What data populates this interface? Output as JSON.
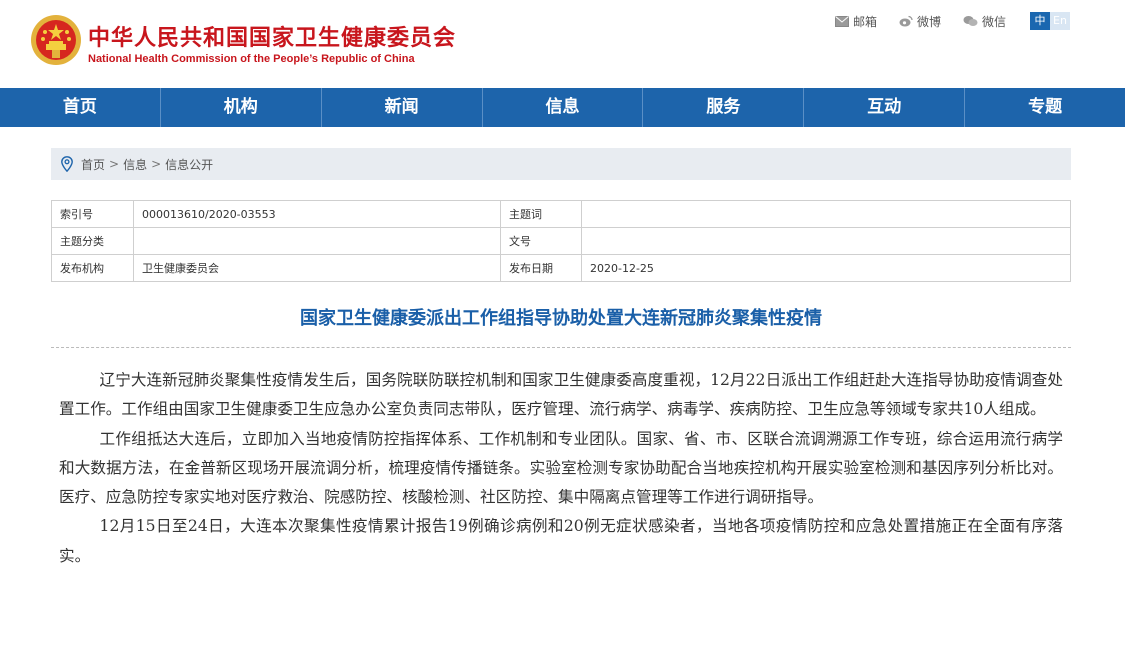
{
  "header": {
    "site_title_cn": "中华人民共和国国家卫生健康委员会",
    "site_title_en": "National Health Commission of the People’s Republic of China",
    "links": [
      {
        "label": "邮箱",
        "icon": "mail-icon"
      },
      {
        "label": "微博",
        "icon": "weibo-icon"
      },
      {
        "label": "微信",
        "icon": "wechat-icon"
      }
    ],
    "lang": {
      "zh": "中",
      "en": "En"
    }
  },
  "nav": {
    "items": [
      "首页",
      "机构",
      "新闻",
      "信息",
      "服务",
      "互动",
      "专题"
    ]
  },
  "breadcrumb": {
    "items": [
      "首页",
      "信息",
      "信息公开"
    ],
    "separator": ">"
  },
  "meta": {
    "rows": [
      {
        "k1": "索引号",
        "v1": "000013610/2020-03553",
        "k2": "主题词",
        "v2": ""
      },
      {
        "k1": "主题分类",
        "v1": "",
        "k2": "文号",
        "v2": ""
      },
      {
        "k1": "发布机构",
        "v1": "卫生健康委员会",
        "k2": "发布日期",
        "v2": "2020-12-25"
      }
    ]
  },
  "article": {
    "title": "国家卫生健康委派出工作组指导协助处置大连新冠肺炎聚集性疫情",
    "paragraphs": [
      "辽宁大连新冠肺炎聚集性疫情发生后，国务院联防联控机制和国家卫生健康委高度重视，12月22日派出工作组赶赴大连指导协助疫情调查处置工作。工作组由国家卫生健康委卫生应急办公室负责同志带队，医疗管理、流行病学、病毒学、疾病防控、卫生应急等领域专家共10人组成。",
      "工作组抵达大连后，立即加入当地疫情防控指挥体系、工作机制和专业团队。国家、省、市、区联合流调溯源工作专班，综合运用流行病学和大数据方法，在金普新区现场开展流调分析，梳理疫情传播链条。实验室检测专家协助配合当地疾控机构开展实验室检测和基因序列分析比对。医疗、应急防控专家实地对医疗救治、院感防控、核酸检测、社区防控、集中隔离点管理等工作进行调研指导。",
      "12月15日至24日，大连本次聚集性疫情累计报告19例确诊病例和20例无症状感染者，当地各项疫情防控和应急处置措施正在全面有序落实。"
    ]
  },
  "colors": {
    "brand_red": "#c8161d",
    "nav_blue": "#1d64ab",
    "title_blue": "#1a5fa8",
    "crumb_bg": "#e8ecf1"
  }
}
